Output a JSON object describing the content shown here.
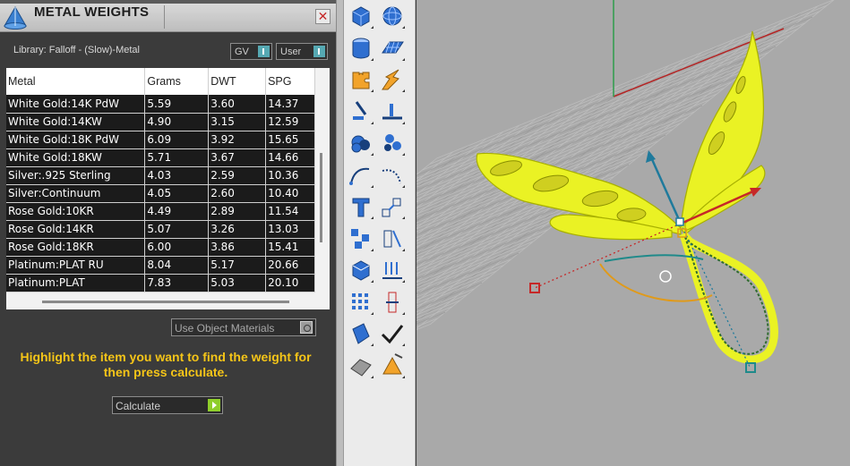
{
  "panel": {
    "title": "METAL WEIGHTS",
    "close_label": "✕",
    "library_label": "Library: Falloff - (Slow)-Metal",
    "toggles": {
      "gv": "GV",
      "user": "User"
    },
    "table": {
      "columns": [
        "Metal",
        "Grams",
        "DWT",
        "SPG"
      ],
      "rows": [
        [
          "White Gold:14K PdW",
          "5.59",
          "3.60",
          "14.37"
        ],
        [
          "White Gold:14KW",
          "4.90",
          "3.15",
          "12.59"
        ],
        [
          "White Gold:18K PdW",
          "6.09",
          "3.92",
          "15.65"
        ],
        [
          "White Gold:18KW",
          "5.71",
          "3.67",
          "14.66"
        ],
        [
          "Silver:.925 Sterling",
          "4.03",
          "2.59",
          "10.36"
        ],
        [
          "Silver:Continuum",
          "4.05",
          "2.60",
          "10.40"
        ],
        [
          "Rose Gold:10KR",
          "4.49",
          "2.89",
          "11.54"
        ],
        [
          "Rose Gold:14KR",
          "5.07",
          "3.26",
          "13.03"
        ],
        [
          "Rose Gold:18KR",
          "6.00",
          "3.86",
          "15.41"
        ],
        [
          "Platinum:PLAT RU",
          "8.04",
          "5.17",
          "20.66"
        ],
        [
          "Platinum:PLAT",
          "7.83",
          "5.03",
          "20.10"
        ]
      ]
    },
    "use_object_materials": "Use Object Materials",
    "hint": "Highlight the item you want to find the weight for then press calculate.",
    "calculate": "Calculate"
  },
  "toolbar": {
    "icons": [
      "box-icon",
      "sphere-icon",
      "cylinder-icon",
      "surface-icon",
      "puzzle-icon",
      "explode-icon",
      "split-icon",
      "trim-icon",
      "boolean-union-icon",
      "boolean-split-icon",
      "curve-icon",
      "fillet-icon",
      "text-icon",
      "scale-icon",
      "array-icon",
      "mirror-icon",
      "render-icon",
      "project-icon",
      "grid-icon",
      "gumball-icon",
      "analyze-icon",
      "check-icon",
      "shaded-view-icon",
      "lights-icon"
    ]
  },
  "colors": {
    "accent": "#f5c518",
    "model": "#eaf224",
    "grid": "#bfbfbf",
    "axis_x": "#b32626",
    "axis_y": "#2c9c4a"
  }
}
